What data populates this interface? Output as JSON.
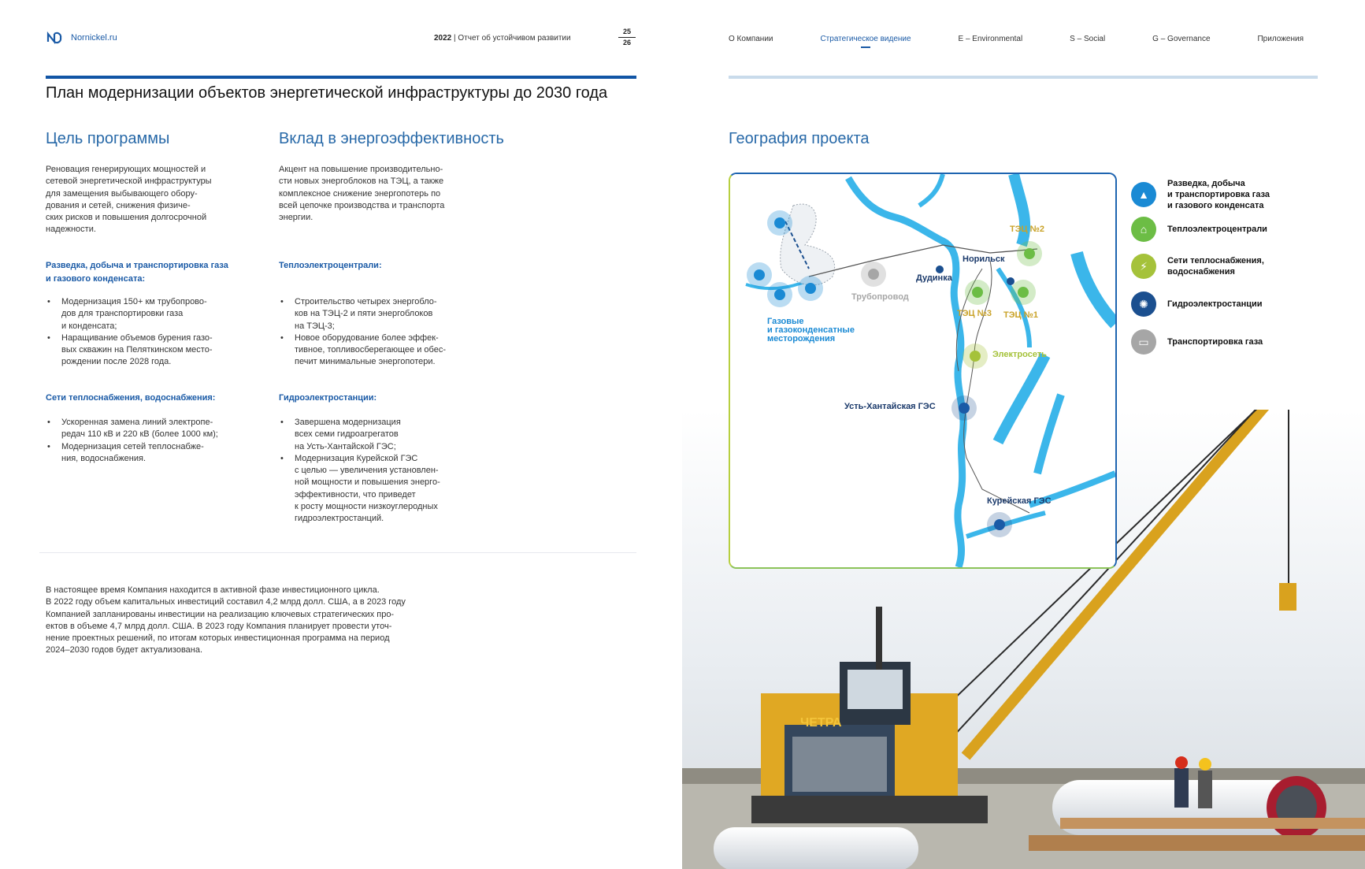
{
  "header": {
    "site": "Nornickel.ru",
    "year": "2022",
    "report_title": "Отчет об устойчивом развитии",
    "page_current": "25",
    "page_total": "26"
  },
  "nav": {
    "items": [
      "О Компании",
      "Стратегическое видение",
      "E – Environmental",
      "S – Social",
      "G – Governance",
      "Приложения"
    ],
    "active": "Стратегическое видение"
  },
  "main_title": "План модернизации объектов энергетической инфраструктуры до 2030 года",
  "goal": {
    "title": "Цель программы",
    "text": "Реновация генерирующих мощностей и\nсетевой энергетической инфраструктуры\nдля замещения выбывающего обору-\nдования и сетей, снижения физиче-\nских рисков и повышения долгосрочной\nнадежности."
  },
  "efficiency": {
    "title": "Вклад в энергоэффективность",
    "text": "Акцент на повышение производительно-\nсти новых энергоблоков на ТЭЦ, а также\nкомплексное снижение энергопотерь по\nвсей цепочке производства и транспорта\nэнергии."
  },
  "gas": {
    "title": "Разведка, добыча и транспортировка газа\nи газового конденсата:",
    "bullets": [
      "Модернизация 150+ км трубопрово-\nдов для транспортировки газа\nи конденсата;",
      "Наращивание объемов бурения газо-\nвых скважин на Пеляткинском место-\nрождении после 2028 года."
    ]
  },
  "chp": {
    "title": "Теплоэлектроцентрали:",
    "bullets": [
      "Строительство четырех энергобло-\nков на ТЭЦ-2 и пяти энергоблоков\nна ТЭЦ-3;",
      "Новое оборудование более эффек-\nтивное, топливосберегающее и обес-\nпечит минимальные энергопотери."
    ]
  },
  "heat": {
    "title": "Сети теплоснабжения, водоснабжения:",
    "bullets": [
      "Ускоренная замена линий электропе-\nредач 110 кВ и 220 кВ (более 1000 км);",
      "Модернизация сетей теплоснабже-\nния, водоснабжения."
    ]
  },
  "hydro": {
    "title": "Гидроэлектростанции:",
    "bullets": [
      "Завершена модернизация\nвсех семи гидроагрегатов\nна Усть-Хантайской ГЭС;",
      "Модернизация Курейской ГЭС\nс целью — увеличения установлен-\nной мощности и повышения энерго-\nэффективности, что приведет\nк росту мощности низкоуглеродных\nгидроэлектростанций."
    ]
  },
  "investment_text": "В настоящее время Компания находится в активной фазе инвестиционного цикла.\nВ 2022 году объем капитальных инвестиций составил 4,2 млрд долл. США, а в 2023 году\nКомпанией запланированы инвестиции на реализацию ключевых стратегических про-\nектов в объеме 4,7 млрд долл. США. В 2023 году Компания планирует провести уточ-\nнение проектных решений, по итогам которых инвестиционная программа на период\n2024–2030 годов будет актуализована.",
  "geo": {
    "title": "География проекта",
    "map_labels": {
      "tec2": "ТЭЦ №2",
      "norilsk": "Норильск",
      "dudinka": "Дудинка",
      "pipeline": "Трубопровод",
      "tec3": "ТЭЦ №3",
      "tec1": "ТЭЦ №1",
      "fields": "Газовые\nи газоконденсатные\nместорождения",
      "elektroset": "Электросеть",
      "ust_khantayskaya": "Усть-Хантайская ГЭС",
      "kureyskaya": "Курейская ГЭС"
    },
    "legend": [
      {
        "label": "Разведка, добыча\nи транспортировка газа\nи газового конденсата",
        "color": "#1a8ad4",
        "icon": "gas-rig-icon"
      },
      {
        "label": "Теплоэлектроцентрали",
        "color": "#6cbd45",
        "icon": "chp-plant-icon"
      },
      {
        "label": "Сети теплоснабжения,\nводоснабжения",
        "color": "#a5c23a",
        "icon": "power-tower-icon"
      },
      {
        "label": "Гидроэлектростанции",
        "color": "#1b4f8f",
        "icon": "hydro-icon"
      },
      {
        "label": "Транспортировка газа",
        "color": "#a6a6a6",
        "icon": "pipe-icon"
      }
    ]
  },
  "photo": {
    "machine_brand": "ЧЕТРА"
  }
}
